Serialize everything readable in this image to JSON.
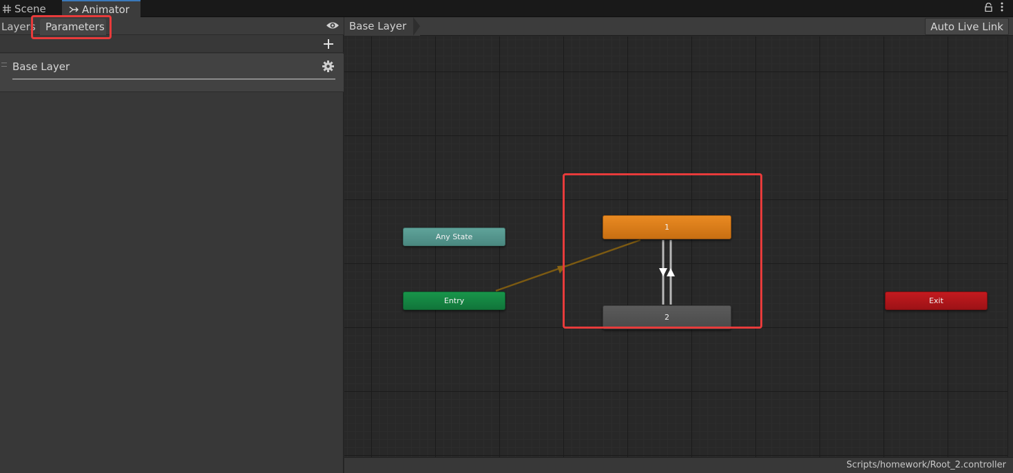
{
  "window_tabs": [
    {
      "label": "Scene",
      "icon": "grid-icon"
    },
    {
      "label": "Animator",
      "icon": "animator-icon"
    }
  ],
  "left_panel": {
    "tabs": {
      "layers": "Layers",
      "parameters": "Parameters"
    },
    "layers": [
      {
        "name": "Base Layer"
      }
    ]
  },
  "graph": {
    "breadcrumb": "Base Layer",
    "auto_live_link": "Auto Live Link",
    "states": {
      "any_state": "Any State",
      "entry": "Entry",
      "exit": "Exit",
      "state1": "1",
      "state2": "2"
    },
    "status_path": "Scripts/homework/Root_2.controller"
  },
  "colors": {
    "annotation": "#e83b3b",
    "any_state": "#5a9a92",
    "entry": "#16884a",
    "exit": "#b8171b",
    "default_state": "#e08020",
    "state": "#555555",
    "active_tab_accent": "#3a79bb"
  }
}
